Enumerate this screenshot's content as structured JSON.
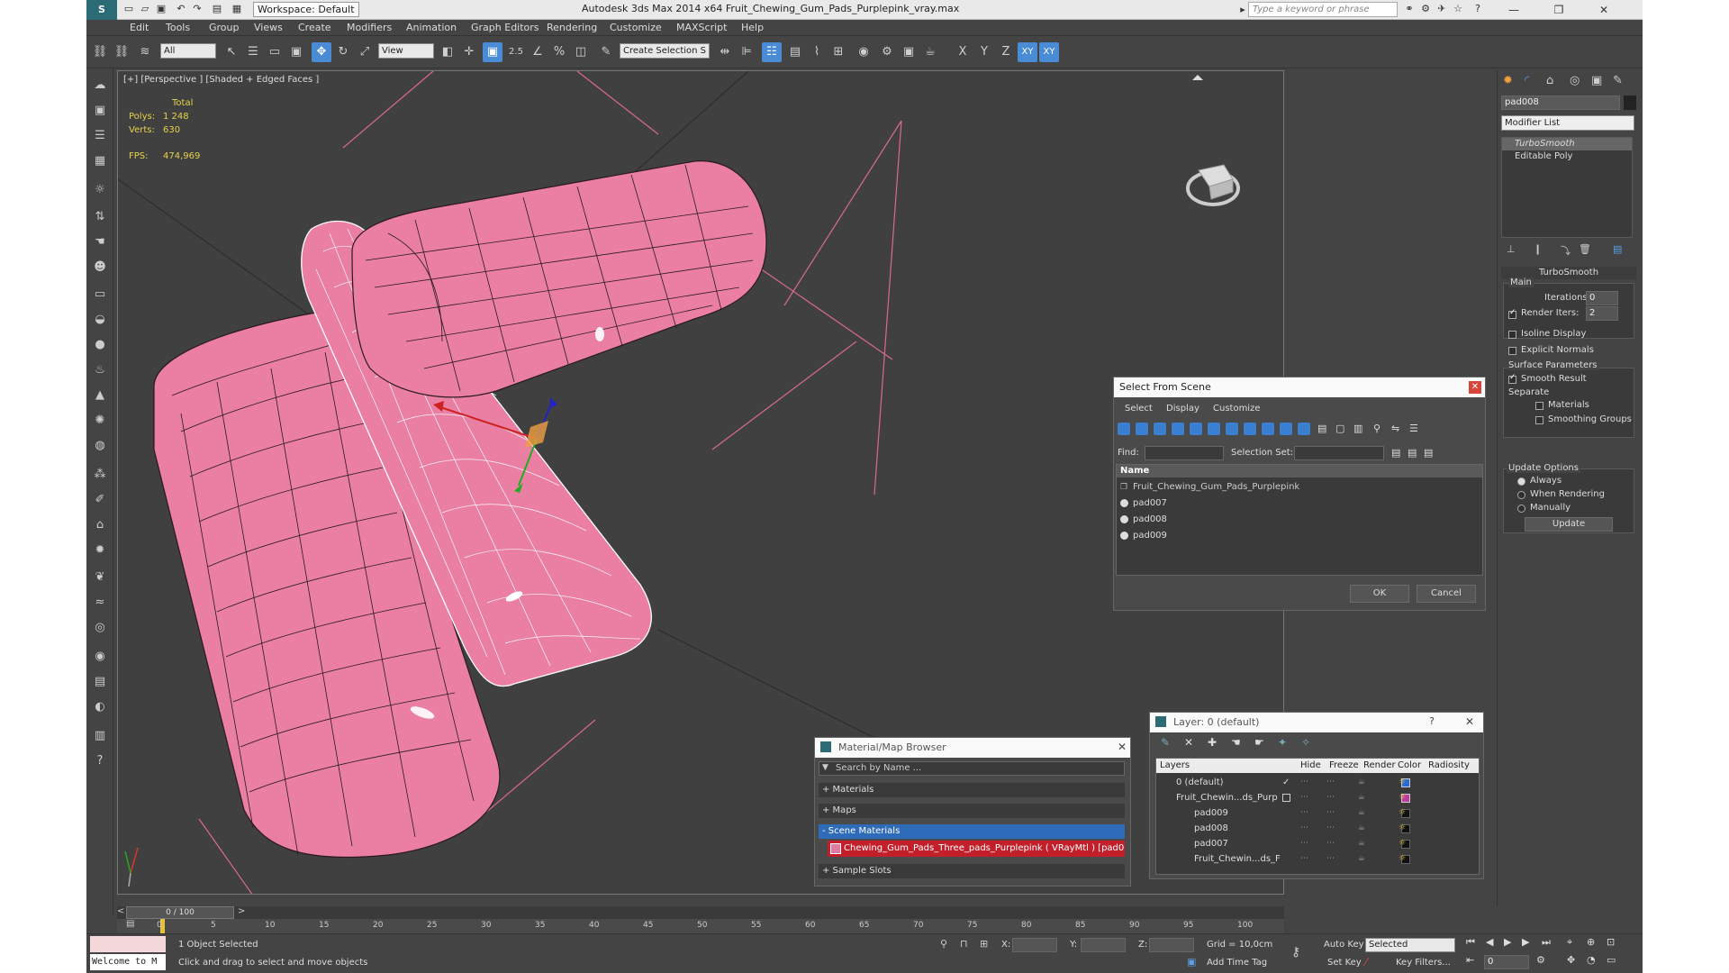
{
  "app": {
    "workspace": "Workspace: Default",
    "window_title": "Autodesk 3ds Max  2014 x64     Fruit_Chewing_Gum_Pads_Purplepink_vray.max",
    "search_placeholder": "Type a keyword or phrase"
  },
  "menu": [
    "Edit",
    "Tools",
    "Group",
    "Views",
    "Create",
    "Modifiers",
    "Animation",
    "Graph Editors",
    "Rendering",
    "Customize",
    "MAXScript",
    "Help"
  ],
  "toolbar": {
    "filter_value": "All",
    "refcoord_value": "View",
    "snap_label": "2.5",
    "named_selection_value": "Create Selection S",
    "axis_x": "X",
    "axis_y": "Y",
    "axis_z": "Z",
    "axis_xy": "XY",
    "axis_xy2": "XY"
  },
  "viewport": {
    "label": "[+] [Perspective ] [Shaded + Edged Faces ]",
    "stats_total": "Total",
    "polys_label": "Polys:",
    "polys_value": "1 248",
    "verts_label": "Verts:",
    "verts_value": "630",
    "fps_label": "FPS:",
    "fps_value": "474,969",
    "mesh_color": "#ea7fa3",
    "mesh_edge_color": "#2a1a20"
  },
  "command_panel": {
    "object_name": "pad008",
    "modifier_list": "Modifier List",
    "stack": [
      "TurboSmooth",
      "Editable Poly"
    ],
    "rollout_title": "TurboSmooth",
    "main_label": "Main",
    "iterations_label": "Iterations:",
    "iterations_value": "0",
    "render_iters_label": "Render Iters:",
    "render_iters_value": "2",
    "isoline": "Isoline Display",
    "explicit_normals": "Explicit Normals",
    "surface_params": "Surface Parameters",
    "smooth_result": "Smooth Result",
    "separate": "Separate",
    "materials": "Materials",
    "smoothing_groups": "Smoothing Groups",
    "update_options": "Update Options",
    "always": "Always",
    "when_rendering": "When Rendering",
    "manually": "Manually",
    "update_btn": "Update"
  },
  "select_from_scene": {
    "title": "Select From Scene",
    "menu": [
      "Select",
      "Display",
      "Customize"
    ],
    "find_label": "Find:",
    "selection_set_label": "Selection Set:",
    "name_header": "Name",
    "items": [
      "Fruit_Chewing_Gum_Pads_Purplepink",
      "pad007",
      "pad008",
      "pad009"
    ],
    "ok": "OK",
    "cancel": "Cancel"
  },
  "material_browser": {
    "title": "Material/Map Browser",
    "search": "Search by Name ...",
    "groups": [
      "+ Materials",
      "+ Maps",
      "- Scene Materials"
    ],
    "scene_material": "Chewing_Gum_Pads_Three_pads_Purplepink ( VRayMtl ) [pad0...",
    "sample_slots": "+ Sample Slots"
  },
  "layer_dialog": {
    "title": "Layer: 0 (default)",
    "help": "?",
    "headers": [
      "Layers",
      "Hide",
      "Freeze",
      "Render",
      "Color",
      "Radiosity"
    ],
    "rows": [
      {
        "name": "0 (default)",
        "color": "#2a6ad6"
      },
      {
        "name": "Fruit_Chewin...ds_Purp",
        "color": "#c23aa0"
      },
      {
        "name": "pad009",
        "color": "#111111"
      },
      {
        "name": "pad008",
        "color": "#111111"
      },
      {
        "name": "pad007",
        "color": "#111111"
      },
      {
        "name": "Fruit_Chewin...ds_F",
        "color": "#111111"
      }
    ]
  },
  "timeline": {
    "frame_counter": "0 / 100",
    "ticks": [
      "0",
      "5",
      "10",
      "15",
      "20",
      "25",
      "30",
      "35",
      "40",
      "45",
      "50",
      "55",
      "60",
      "65",
      "70",
      "75",
      "80",
      "85",
      "90",
      "95",
      "100"
    ]
  },
  "status": {
    "maxscript": "Welcome to M",
    "selected": "1 Object Selected",
    "prompt": "Click and drag to select and move objects",
    "x_label": "X:",
    "y_label": "Y:",
    "z_label": "Z:",
    "grid": "Grid = 10,0cm",
    "add_time_tag": "Add Time Tag",
    "auto_key": "Auto Key",
    "set_key": "Set Key",
    "selected_dropdown": "Selected",
    "key_filters": "Key Filters...",
    "frame_value": "0"
  }
}
